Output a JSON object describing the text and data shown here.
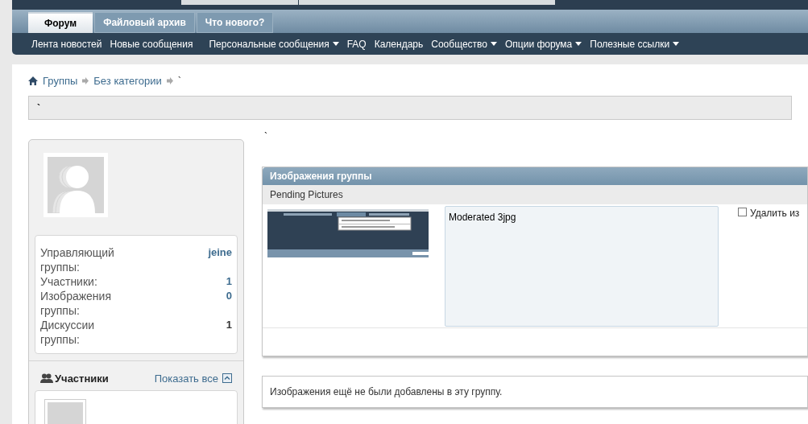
{
  "tabs": [
    {
      "label": "Форум",
      "selected": true
    },
    {
      "label": "Файловый архив",
      "selected": false
    },
    {
      "label": "Что нового?",
      "selected": false
    }
  ],
  "subnav": [
    {
      "label": "Лента новостей",
      "dropdown": false
    },
    {
      "label": "Новые сообщения",
      "dropdown": false
    },
    {
      "label": "Персональные сообщения",
      "dropdown": true
    },
    {
      "label": "FAQ",
      "dropdown": false
    },
    {
      "label": "Календарь",
      "dropdown": false
    },
    {
      "label": "Сообщество",
      "dropdown": true
    },
    {
      "label": "Опции форума",
      "dropdown": true
    },
    {
      "label": "Полезные ссылки",
      "dropdown": true
    }
  ],
  "breadcrumb": [
    "Группы",
    "Без категории",
    "`"
  ],
  "group_title": "`",
  "description": "`",
  "sidebar": {
    "stats": [
      {
        "label": "Управляющий группы:",
        "value": "jeine",
        "link": true
      },
      {
        "label": "Участники:",
        "value": "1",
        "link": true
      },
      {
        "label": "Изображения группы:",
        "value": "0",
        "link": true
      },
      {
        "label": "Дискуссии группы:",
        "value": "1",
        "link": false
      }
    ],
    "members": {
      "title": "Участники",
      "show_all": "Показать все"
    }
  },
  "pictures_panel": {
    "title": "Изображения группы",
    "subtitle": "Pending Pictures",
    "items": [
      {
        "caption": "Moderated 3jpg",
        "delete_label": "Удалить из",
        "checked": false
      }
    ]
  },
  "empty_message": "Изображения ещё не были добавлены в эту группу."
}
